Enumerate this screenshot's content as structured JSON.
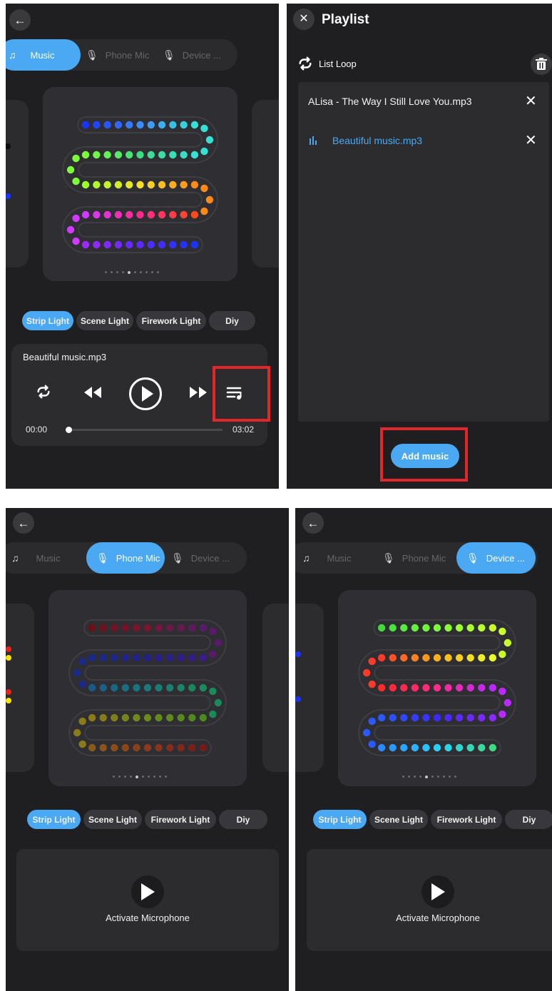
{
  "source_tabs": [
    {
      "label": "Music",
      "icon": "music-note-icon"
    },
    {
      "label": "Phone Mic",
      "icon": "microphone-icon"
    },
    {
      "label": "Device ...",
      "icon": "microphone-icon"
    }
  ],
  "light_types": [
    "Strip Light",
    "Scene Light",
    "Firework Light",
    "Diy"
  ],
  "player": {
    "track": "Beautiful music.mp3",
    "current_time": "00:00",
    "total_time": "03:02",
    "progress": 0
  },
  "playlist": {
    "title": "Playlist",
    "loop_mode": "List Loop",
    "items": [
      {
        "name": "ALisa - The Way I Still Love You.mp3",
        "playing": false
      },
      {
        "name": "Beautiful music.mp3",
        "playing": true
      }
    ],
    "add_button": "Add music"
  },
  "mic": {
    "activate_label": "Activate Microphone"
  },
  "colors": {
    "accent": "#4aa9f2",
    "background": "#1f1f21",
    "card": "#2c2c2f",
    "highlight": "#e3262b"
  }
}
